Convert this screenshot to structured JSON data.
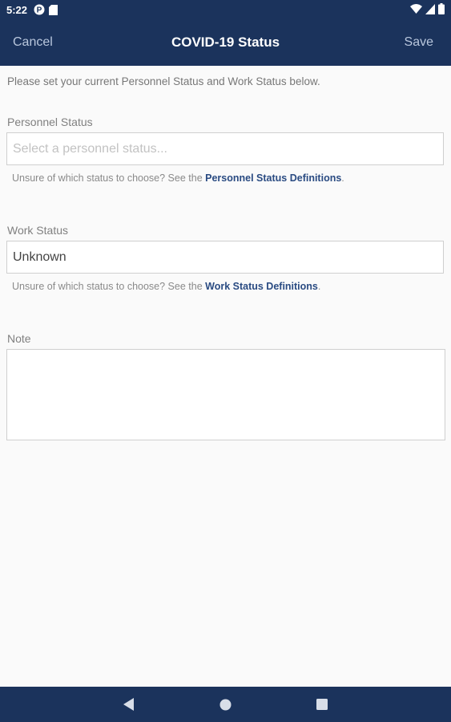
{
  "status_bar": {
    "time": "5:22",
    "left_icons": [
      "notification-p-icon",
      "sd-card-icon"
    ],
    "right_icons": [
      "wifi-icon",
      "signal-icon",
      "battery-icon"
    ]
  },
  "app_bar": {
    "cancel_label": "Cancel",
    "title": "COVID-19 Status",
    "save_label": "Save",
    "background_color": "#1b335c"
  },
  "form": {
    "intro": "Please set your current Personnel Status and Work Status below.",
    "personnel_status": {
      "label": "Personnel Status",
      "placeholder": "Select a personnel status...",
      "value": "",
      "help_prefix": "Unsure of which status to choose? See the ",
      "help_link": "Personnel Status Definitions",
      "help_suffix": "."
    },
    "work_status": {
      "label": "Work Status",
      "value": "Unknown",
      "help_prefix": "Unsure of which status to choose? See the ",
      "help_link": "Work Status Definitions",
      "help_suffix": "."
    },
    "note": {
      "label": "Note",
      "value": ""
    }
  },
  "nav_bar": {
    "buttons": [
      "back-icon",
      "home-icon",
      "recents-icon"
    ]
  }
}
